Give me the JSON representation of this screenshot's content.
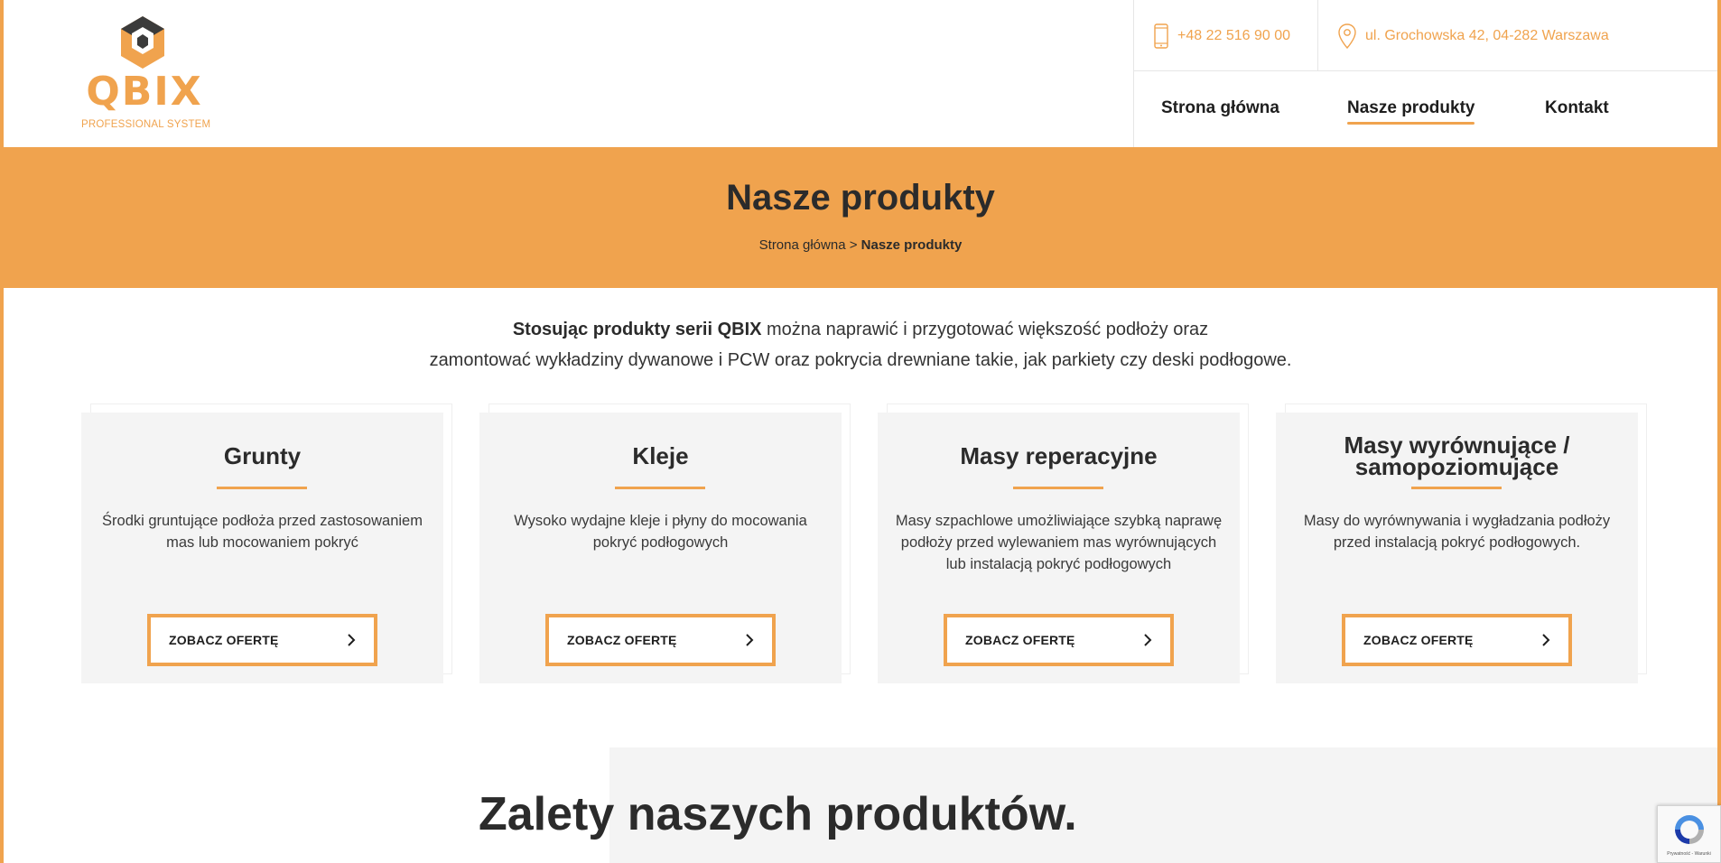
{
  "brand": {
    "name": "QBIX",
    "tagline": "PROFESSIONAL SYSTEM",
    "accent": "#f0a34e"
  },
  "contact": {
    "phone": "+48 22 516 90 00",
    "address": "ul. Grochowska 42, 04-282 Warszawa"
  },
  "nav": [
    {
      "label": "Strona główna",
      "active": false
    },
    {
      "label": "Nasze produkty",
      "active": true
    },
    {
      "label": "Kontakt",
      "active": false
    }
  ],
  "hero": {
    "title_bold": "Nasze",
    "title_rest": " produkty",
    "breadcrumb_home": "Strona główna",
    "breadcrumb_sep": " > ",
    "breadcrumb_current": "Nasze produkty"
  },
  "intro": {
    "bold": "Stosując produkty serii QBIX",
    "line1_rest": " można naprawić i przygotować większość podłoży oraz",
    "line2": "zamontować wykładziny dywanowe i PCW oraz pokrycia drewniane takie, jak parkiety czy deski podłogowe."
  },
  "products": [
    {
      "title": "Grunty",
      "description": "Środki gruntujące podłoża przed zastosowaniem mas lub mocowaniem pokryć",
      "button": "ZOBACZ OFERTĘ"
    },
    {
      "title": "Kleje",
      "description": "Wysoko wydajne kleje i płyny do mocowania pokryć podłogowych",
      "button": "ZOBACZ OFERTĘ"
    },
    {
      "title": "Masy reperacyjne",
      "description": "Masy szpachlowe umożliwiające szybką naprawę podłoży przed wylewaniem mas wyrównujących lub instalacją pokryć podłogowych",
      "button": "ZOBACZ OFERTĘ"
    },
    {
      "title": "Masy wyrównujące / samopoziomujące",
      "description": "Masy do wyrównywania i wygładzania podłoży przed instalacją pokryć podłogowych.",
      "button": "ZOBACZ OFERTĘ"
    }
  ],
  "advantages": {
    "title_bold": "Zalety",
    "title_rest": " naszych produktów."
  },
  "recaptcha": {
    "text": "Prywatność - Warunki"
  }
}
